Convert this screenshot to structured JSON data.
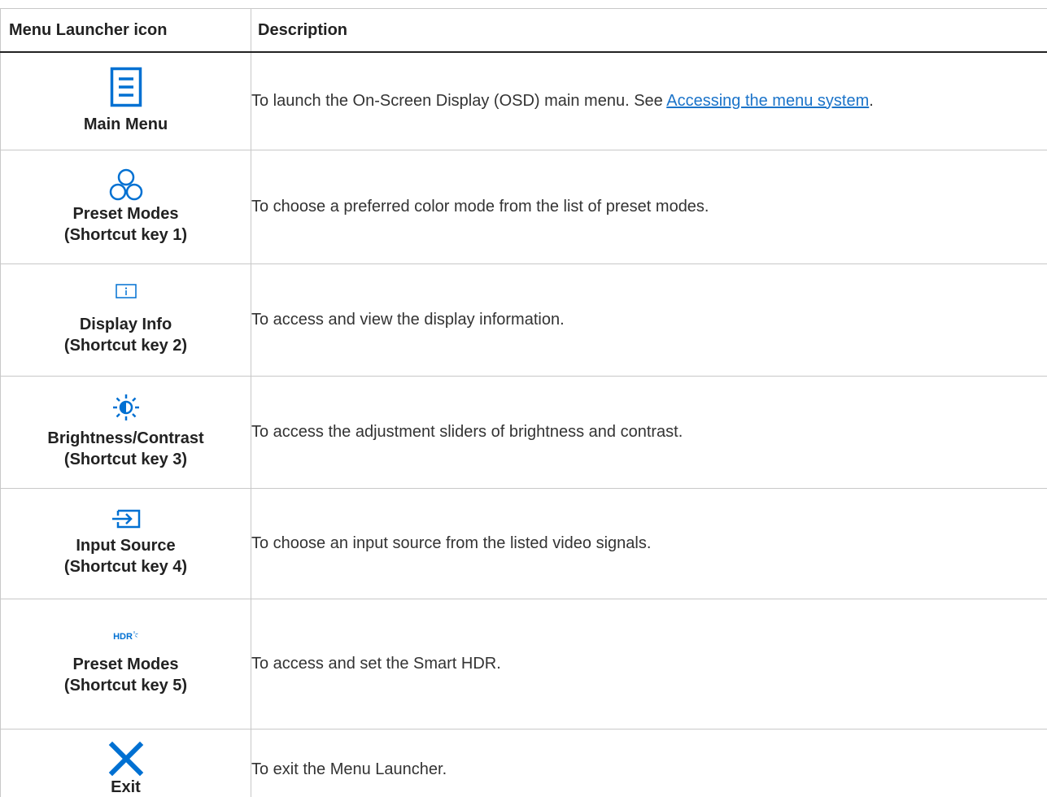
{
  "header": {
    "col_icon": "Menu Launcher icon",
    "col_desc": "Description"
  },
  "colors": {
    "icon_blue": "#0070d2",
    "link_blue": "#1a73c9"
  },
  "rows": [
    {
      "icon": "main-menu-icon",
      "label": "Main Menu",
      "desc_prefix": "To launch the On-Screen Display (OSD) main menu. See ",
      "link": "Accessing the menu system",
      "desc_suffix": "."
    },
    {
      "icon": "preset-modes-icon",
      "label": "Preset Modes",
      "sublabel": "(Shortcut key 1)",
      "desc": "To choose a preferred color mode from the list of preset modes."
    },
    {
      "icon": "display-info-icon",
      "label": "Display Info",
      "sublabel": "(Shortcut key 2)",
      "desc": "To access and view the display information."
    },
    {
      "icon": "brightness-contrast-icon",
      "label": "Brightness/Contrast",
      "sublabel": "(Shortcut key 3)",
      "desc": "To access the adjustment sliders of brightness and contrast."
    },
    {
      "icon": "input-source-icon",
      "label": "Input Source",
      "sublabel": "(Shortcut key 4)",
      "desc": "To choose an input source from the listed video signals."
    },
    {
      "icon": "hdr-icon",
      "icon_text": "HDR",
      "label": "Preset Modes",
      "sublabel": "(Shortcut key 5)",
      "desc": "To access and set the Smart HDR."
    },
    {
      "icon": "close-icon",
      "label": "Exit",
      "desc": "To exit the Menu Launcher."
    }
  ]
}
